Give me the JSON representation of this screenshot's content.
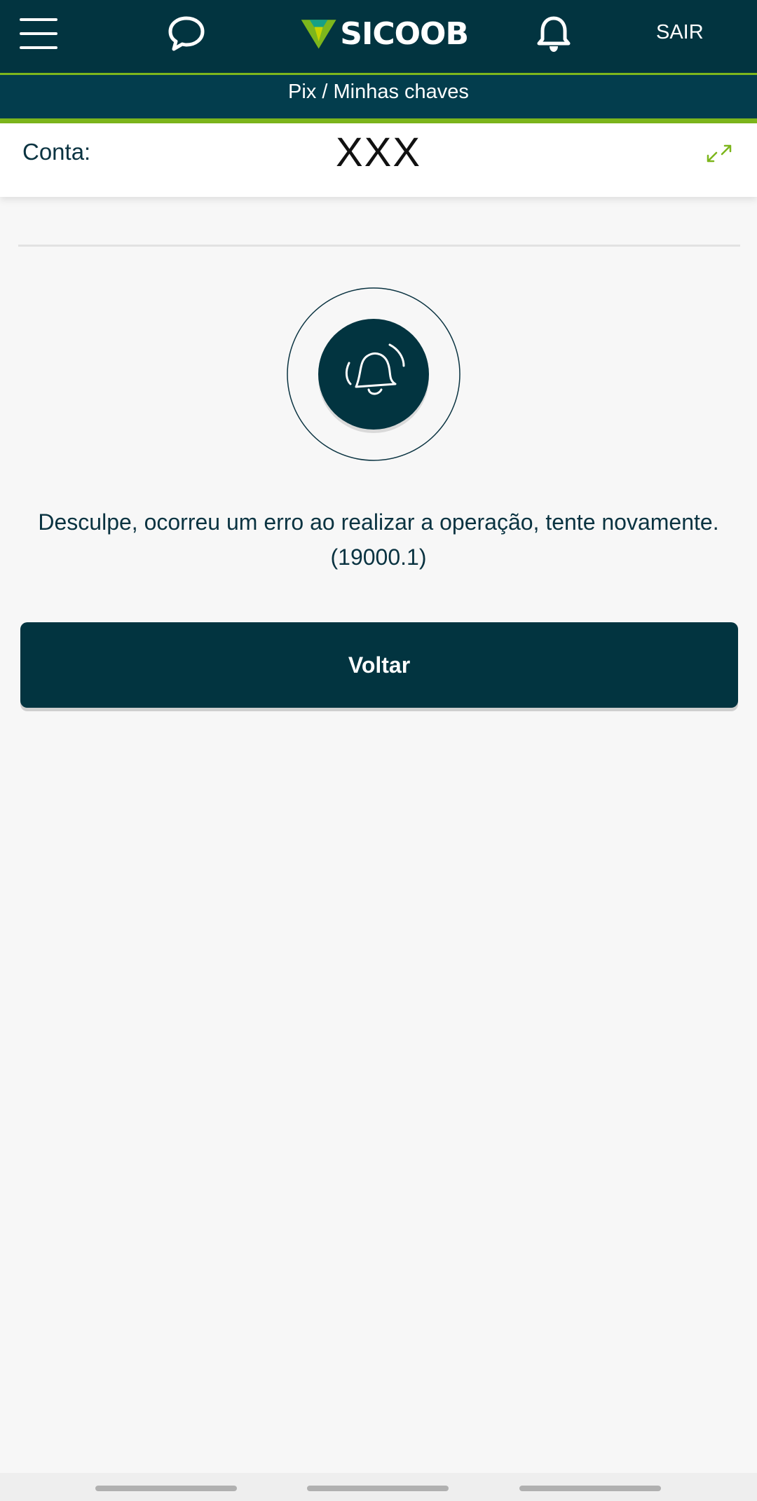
{
  "header": {
    "menu_icon": "hamburger-menu-icon",
    "chat_icon": "chat-bubble-icon",
    "logo_text": "SICOOB",
    "bell_icon": "bell-icon",
    "logout_label": "SAIR"
  },
  "breadcrumb": {
    "text": "Pix / Minhas chaves"
  },
  "account": {
    "label": "Conta:",
    "value": "XXX",
    "expand_icon": "expand-arrows-icon"
  },
  "error": {
    "icon": "ringing-bell-icon",
    "message": "Desculpe, ocorreu um erro ao realizar a operação, tente novamente. (19000.1)"
  },
  "actions": {
    "back_label": "Voltar"
  },
  "colors": {
    "primary": "#023440",
    "accent": "#7db61c",
    "background": "#f7f7f7"
  }
}
